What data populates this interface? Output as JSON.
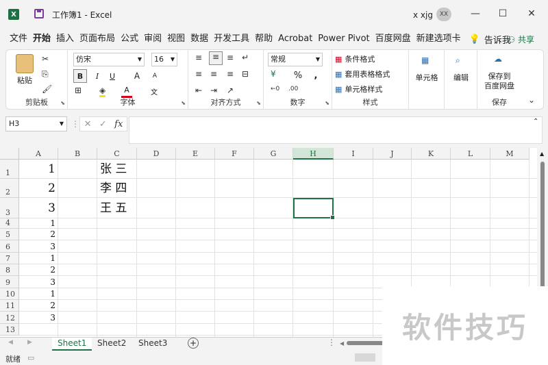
{
  "window": {
    "title": "工作簿1 - Excel",
    "app_icon": "X",
    "user_name": "x xjg",
    "user_initials": "XX",
    "minimize_icon": "—",
    "maximize_icon": "☐",
    "close_icon": "✕"
  },
  "menu": {
    "items": [
      "文件",
      "开始",
      "插入",
      "页面布局",
      "公式",
      "审阅",
      "视图",
      "数据",
      "开发工具",
      "帮助",
      "Acrobat",
      "Power Pivot",
      "百度网盘",
      "新建选项卡"
    ],
    "active": "开始",
    "tell_me": "告诉我",
    "share": "共享"
  },
  "ribbon": {
    "clipboard": {
      "label": "剪贴板",
      "paste": "粘贴"
    },
    "font": {
      "label": "字体",
      "font_name": "仿宋",
      "font_size": "16",
      "bold": "B",
      "italic": "I",
      "underline": "U",
      "grow": "A",
      "shrink": "A",
      "wen": "文"
    },
    "align": {
      "label": "对齐方式"
    },
    "number": {
      "label": "数字",
      "format": "常规",
      "percent": "%",
      "comma": ","
    },
    "styles": {
      "label": "样式",
      "conditional": "条件格式",
      "table": "套用表格格式",
      "cell_styles": "单元格样式"
    },
    "cells": {
      "label": "单元格"
    },
    "edit": {
      "label": "编辑"
    },
    "save": {
      "label": "保存",
      "save_to": "保存到",
      "baidu": "百度网盘"
    }
  },
  "formula_bar": {
    "name_box": "H3",
    "cancel": "✕",
    "enter": "✓",
    "fx": "fx",
    "value": ""
  },
  "grid": {
    "columns": [
      "A",
      "B",
      "C",
      "D",
      "E",
      "F",
      "G",
      "H",
      "I",
      "J",
      "K",
      "L",
      "M"
    ],
    "selected_column": "H",
    "rows": [
      "1",
      "2",
      "3",
      "4",
      "5",
      "6",
      "7",
      "8",
      "9",
      "10",
      "11",
      "12",
      "13"
    ],
    "cells": {
      "A1": "1",
      "A2": "2",
      "A3": "3",
      "C1": "张 三",
      "C2": "李 四",
      "C3": "王 五",
      "A4": "1",
      "A5": "2",
      "A6": "3",
      "A7": "1",
      "A8": "2",
      "A9": "3",
      "A10": "1",
      "A11": "2",
      "A12": "3"
    },
    "selected_cell": "H3"
  },
  "sheets": {
    "tabs": [
      "Sheet1",
      "Sheet2",
      "Sheet3"
    ],
    "active": "Sheet1",
    "add": "+"
  },
  "status": {
    "text": "就绪"
  },
  "watermark": "软件技巧",
  "colors": {
    "accent": "#1e7145"
  }
}
